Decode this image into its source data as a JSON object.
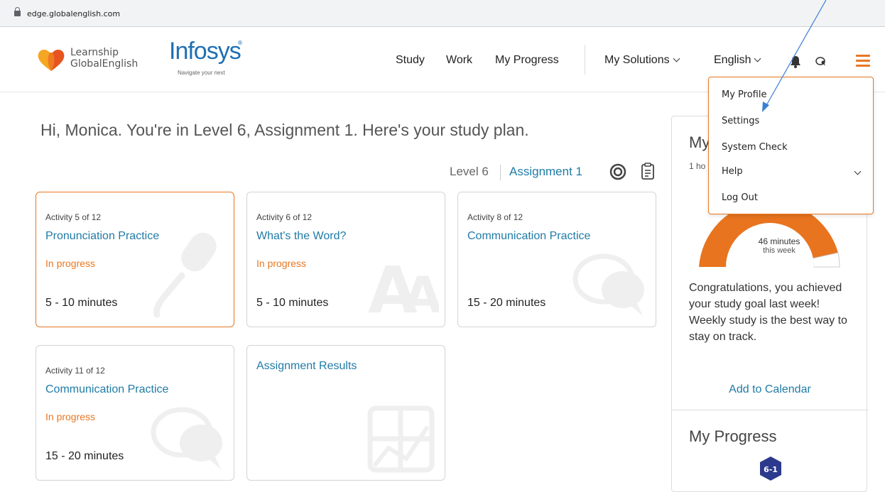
{
  "browser": {
    "url": "edge.globalenglish.com"
  },
  "header": {
    "brand_line1": "Learnship",
    "brand_line2": "GlobalEnglish",
    "partner_name": "Infosys",
    "partner_tagline": "Navigate your next",
    "nav": {
      "study": "Study",
      "work": "Work",
      "my_progress": "My Progress",
      "my_solutions": "My Solutions",
      "language": "English"
    }
  },
  "greeting": "Hi, Monica. You're in Level 6, Assignment 1. Here's your study plan.",
  "level": {
    "level_label": "Level 6",
    "assignment_label": "Assignment 1"
  },
  "cards": [
    {
      "activity": "Activity 5 of 12",
      "title": "Pronunciation Practice",
      "status": "In progress",
      "duration": "5 - 10 minutes"
    },
    {
      "activity": "Activity 6 of 12",
      "title": "What's the Word?",
      "status": "In progress",
      "duration": "5 - 10 minutes"
    },
    {
      "activity": "Activity 8 of 12",
      "title": "Communication Practice",
      "status": "",
      "duration": "15 - 20 minutes"
    },
    {
      "activity": "Activity 11 of 12",
      "title": "Communication Practice",
      "status": "In progress",
      "duration": "15 - 20 minutes"
    },
    {
      "title": "Assignment Results"
    }
  ],
  "side": {
    "heading_partial": "My",
    "hours_partial": "1 ho",
    "gauge_value": "46 minutes",
    "gauge_period": "this week",
    "gauge_fraction": 0.72,
    "message": "Congratulations, you achieved your study goal last week! Weekly study is the best way to stay on track.",
    "add_calendar": "Add to Calendar",
    "progress_heading": "My Progress",
    "progress_badge": "6-1"
  },
  "dropdown": {
    "my_profile": "My Profile",
    "settings": "Settings",
    "system_check": "System Check",
    "help": "Help",
    "log_out": "Log Out"
  },
  "colors": {
    "accent": "#e87722",
    "link": "#1f7ba6",
    "brand_blue": "#1f6fb3"
  }
}
